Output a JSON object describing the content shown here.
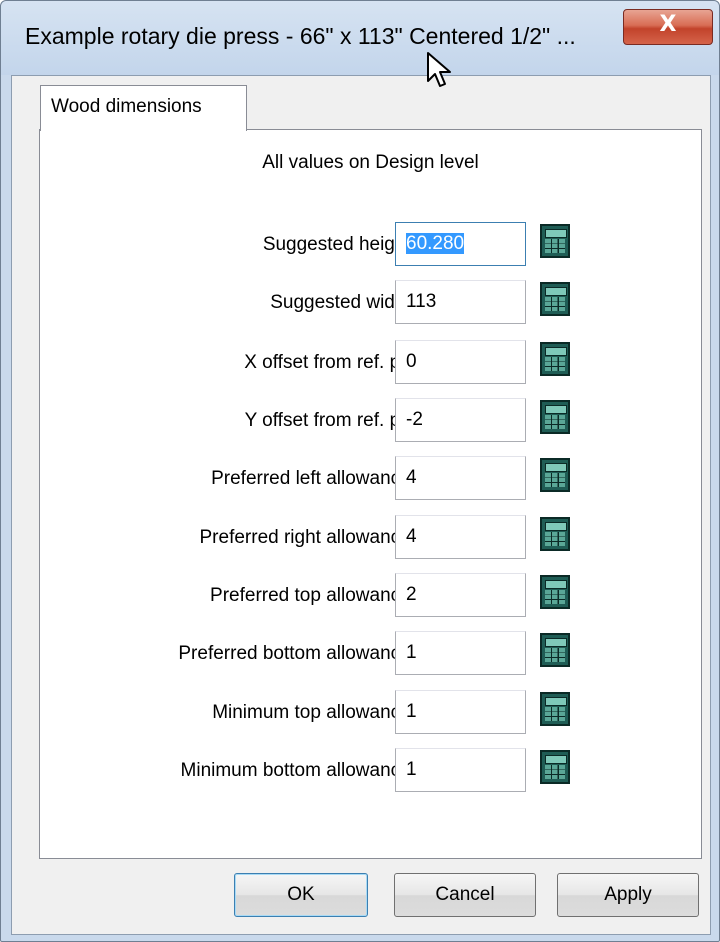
{
  "window": {
    "title": "Example rotary die press - 66\"  x  113\" Centered 1/2\" ...",
    "close_glyph": "X"
  },
  "tab": {
    "label": "Wood dimensions"
  },
  "note": "All values on Design level",
  "fields": [
    {
      "label": "Suggested height:",
      "value": "60.280",
      "focused": true
    },
    {
      "label": "Suggested width:",
      "value": "113"
    },
    {
      "label": "X offset from ref. pt.:",
      "value": "0"
    },
    {
      "label": "Y offset from ref. pt.:",
      "value": "-2"
    },
    {
      "label": "Preferred left allowance:",
      "value": "4"
    },
    {
      "label": "Preferred right allowance:",
      "value": "4"
    },
    {
      "label": "Preferred top allowance:",
      "value": "2"
    },
    {
      "label": "Preferred bottom allowance:",
      "value": "1"
    },
    {
      "label": "Minimum top allowance:",
      "value": "1"
    },
    {
      "label": "Minimum bottom allowance:",
      "value": "1"
    }
  ],
  "buttons": {
    "ok": "OK",
    "cancel": "Cancel",
    "apply": "Apply"
  },
  "icons": {
    "field_button": "calculator-icon",
    "cursor": "mouse-pointer-icon"
  },
  "colors": {
    "title_bar": "#c3d5eb",
    "close_button": "#c2432b",
    "calculator": "#1f5d55",
    "focus": "#3399ff"
  }
}
